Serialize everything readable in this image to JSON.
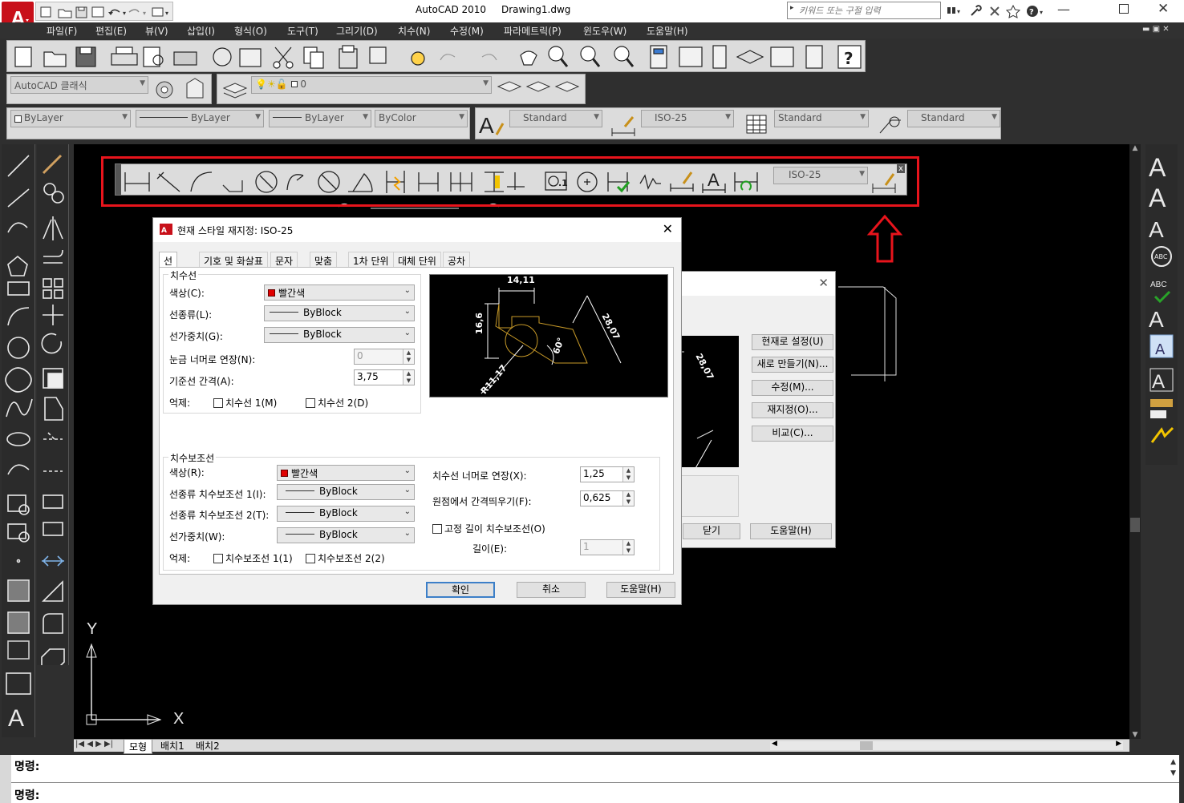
{
  "window": {
    "title": "AutoCAD 2010",
    "document": "Drawing1.dwg"
  },
  "search": {
    "placeholder": "키워드 또는 구절 입력"
  },
  "menu": [
    "파일(F)",
    "편집(E)",
    "뷰(V)",
    "삽입(I)",
    "형식(O)",
    "도구(T)",
    "그리기(D)",
    "치수(N)",
    "수정(M)",
    "파라메트릭(P)",
    "윈도우(W)",
    "도움말(H)"
  ],
  "workspace": {
    "value": "AutoCAD 클래식"
  },
  "layer": {
    "value": "0"
  },
  "properties": {
    "color": "ByLayer",
    "linetype": "ByLayer",
    "lineweight": "ByLayer",
    "plotstyle": "ByColor"
  },
  "styles": {
    "text": "Standard",
    "dim": "ISO-25",
    "table": "Standard",
    "mleader": "Standard"
  },
  "dim_toolbar": {
    "style": "ISO-25"
  },
  "dialog": {
    "title": "현재 스타일 재지정: ISO-25",
    "tabs": [
      "선",
      "기호 및 화살표",
      "문자",
      "맞춤",
      "1차 단위",
      "대체 단위",
      "공차"
    ],
    "dimline": {
      "group": "치수선",
      "color_label": "색상(C):",
      "color_value": "빨간색",
      "linetype_label": "선종류(L):",
      "linetype_value": "ByBlock",
      "lineweight_label": "선가중치(G):",
      "lineweight_value": "ByBlock",
      "extend_label": "눈금 너머로 연장(N):",
      "extend_value": "0",
      "baseline_label": "기준선 간격(A):",
      "baseline_value": "3,75",
      "suppress_label": "억제:",
      "suppress1": "치수선 1(M)",
      "suppress2": "치수선 2(D)"
    },
    "extline": {
      "group": "치수보조선",
      "color_label": "색상(R):",
      "color_value": "빨간색",
      "lt1_label": "선종류 치수보조선 1(I):",
      "lt1_value": "ByBlock",
      "lt2_label": "선종류 치수보조선 2(T):",
      "lt2_value": "ByBlock",
      "lw_label": "선가중치(W):",
      "lw_value": "ByBlock",
      "suppress_label": "억제:",
      "suppress1": "치수보조선 1(1)",
      "suppress2": "치수보조선 2(2)",
      "beyond_label": "치수선 너머로 연장(X):",
      "beyond_value": "1,25",
      "offset_label": "원점에서 간격띄우기(F):",
      "offset_value": "0,625",
      "fixed_label": "고정 길이 치수보조선(O)",
      "length_label": "길이(E):",
      "length_value": "1"
    },
    "preview": {
      "d1": "14,11",
      "d2": "16,6",
      "d3": "28,07",
      "d4": "60°",
      "d5": "R11,17"
    },
    "buttons": {
      "ok": "확인",
      "cancel": "취소",
      "help": "도움말(H)"
    }
  },
  "back_dialog": {
    "buttons": [
      "현재로 설정(U)",
      "새로 만들기(N)...",
      "수정(M)...",
      "재지정(O)...",
      "비교(C)..."
    ],
    "close": "닫기",
    "help": "도움말(H)",
    "preview_dim": "28,07"
  },
  "layout_tabs": [
    "모형",
    "배치1",
    "배치2"
  ],
  "ucs": {
    "x": "X",
    "y": "Y"
  },
  "command": {
    "line1": "명령:",
    "line2": "명령:"
  },
  "colors": {
    "highlight": "#e8141c",
    "red_swatch": "#e00000",
    "canvas": "#000000"
  }
}
